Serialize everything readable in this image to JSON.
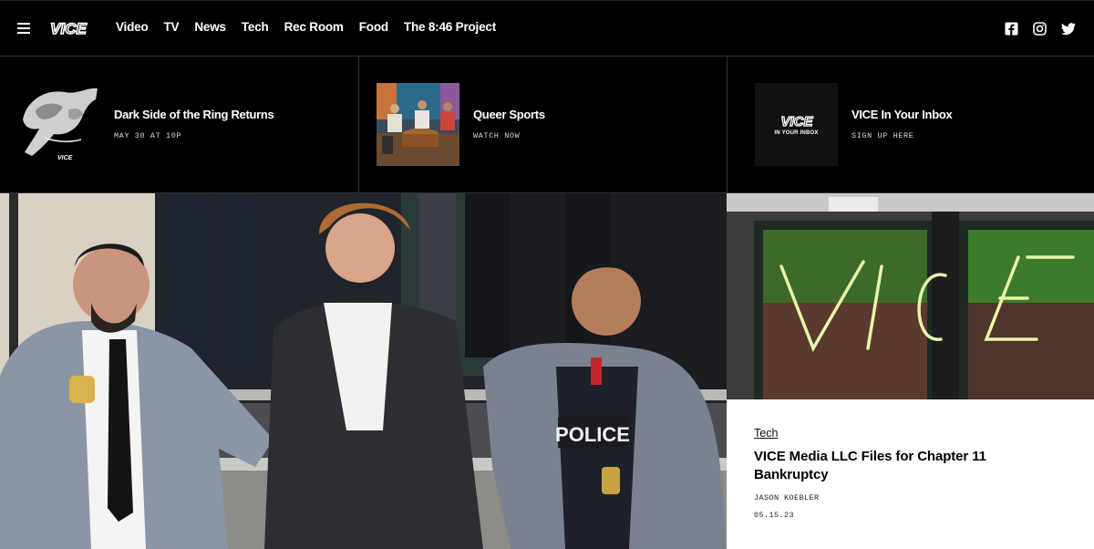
{
  "nav": {
    "logo": "VICE",
    "links": [
      "Video",
      "TV",
      "News",
      "Tech",
      "Rec Room",
      "Food",
      "The 8:46 Project"
    ],
    "social_icons": [
      "facebook-icon",
      "instagram-icon",
      "twitter-icon"
    ]
  },
  "promos": [
    {
      "title": "Dark Side of the Ring Returns",
      "subtitle": "MAY 30 AT 10P"
    },
    {
      "title": "Queer Sports",
      "subtitle": "WATCH NOW"
    },
    {
      "title": "VICE In Your Inbox",
      "subtitle": "SIGN UP HERE",
      "thumb_logo": "VICE",
      "thumb_caption": "IN YOUR INBOX"
    }
  ],
  "hero": {
    "badge_text": "POLICE"
  },
  "feature": {
    "category": "Tech",
    "title": "VICE Media LLC Files for Chapter 11 Bankruptcy",
    "author": "JASON KOEBLER",
    "date": "05.15.23"
  },
  "colors": {
    "background": "#000000",
    "card_bg": "#ffffff",
    "text_light": "#ffffff",
    "text_dark": "#000000",
    "neon": "#e8f5a8"
  }
}
